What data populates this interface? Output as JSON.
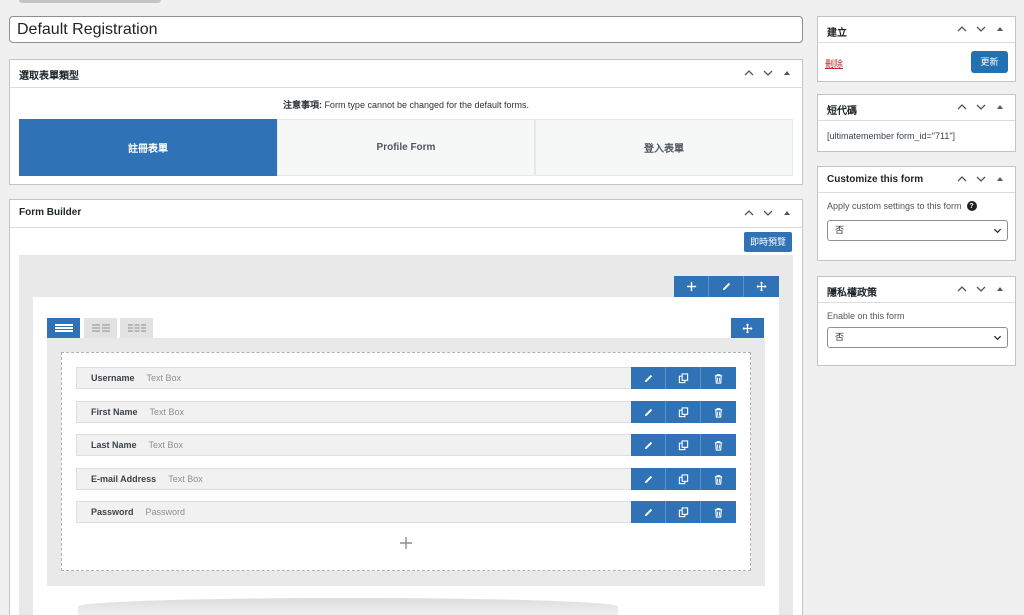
{
  "title_field": {
    "value": "Default Registration"
  },
  "form_type": {
    "title": "選取表單類型",
    "note_strong": "注意事項:",
    "note_text": " Form type cannot be changed for the default forms.",
    "tabs": [
      {
        "label": "註冊表單",
        "active": true
      },
      {
        "label": "Profile Form",
        "active": false
      },
      {
        "label": "登入表單",
        "active": false
      }
    ]
  },
  "form_builder": {
    "title": "Form Builder",
    "preview_label": "即時預覽",
    "fields": [
      {
        "label": "Username",
        "type": "Text Box"
      },
      {
        "label": "First Name",
        "type": "Text Box"
      },
      {
        "label": "Last Name",
        "type": "Text Box"
      },
      {
        "label": "E-mail Address",
        "type": "Text Box"
      },
      {
        "label": "Password",
        "type": "Password"
      }
    ]
  },
  "sidebar": {
    "publish": {
      "title": "建立",
      "delete_label": "刪除",
      "update_label": "更新"
    },
    "shortcode": {
      "title": "短代碼",
      "value": "[ultimatemember form_id=\"711\"]"
    },
    "customize": {
      "title": "Customize this form",
      "description": "Apply custom settings to this form",
      "help_icon": "?",
      "select_value": "否"
    },
    "privacy": {
      "title": "隱私權政策",
      "description": "Enable on this form",
      "select_value": "否"
    }
  },
  "colors": {
    "accent": "#2f72b5",
    "delete": "#b32d2e",
    "update": "#2271b1"
  }
}
